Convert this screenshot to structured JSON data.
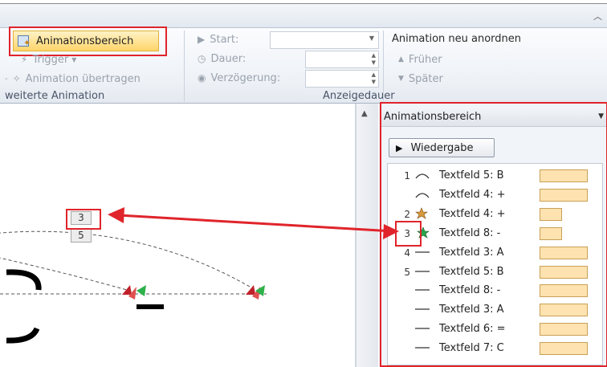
{
  "ribbon": {
    "collapse_icon": "chevron-up-icon",
    "advanced": {
      "anim_pane_button": "Animationsbereich",
      "trigger": "Trigger",
      "anim_painter": "Animation übertragen",
      "group_label": "weiterte Animation"
    },
    "timing": {
      "start_label": "Start:",
      "duration_label": "Dauer:",
      "delay_label": "Verzögerung:",
      "group_label": "Anzeigedauer"
    },
    "reorder": {
      "title": "Animation neu anordnen",
      "earlier": "Früher",
      "later": "Später"
    }
  },
  "slide": {
    "tag_top": "3",
    "tag_bottom": "5"
  },
  "pane": {
    "title": "Animationsbereich",
    "play_label": "Wiedergabe",
    "items": [
      {
        "num": "1",
        "icon": "arc-path-icon",
        "label": "Textfeld 5: B",
        "bar": 58
      },
      {
        "num": "",
        "icon": "arc-path-icon",
        "label": "Textfeld 4: +",
        "bar": 58
      },
      {
        "num": "2",
        "icon": "star-emphasis-icon",
        "label": "Textfeld 4: +",
        "bar": 26
      },
      {
        "num": "3",
        "icon": "star-emphasis-icon",
        "label": "Textfeld 8: -",
        "bar": 26
      },
      {
        "num": "4",
        "icon": "line-path-icon",
        "label": "Textfeld 3: A",
        "bar": 58
      },
      {
        "num": "5",
        "icon": "line-path-icon",
        "label": "Textfeld 5: B",
        "bar": 58
      },
      {
        "num": "",
        "icon": "line-path-icon",
        "label": "Textfeld 8: -",
        "bar": 58
      },
      {
        "num": "",
        "icon": "line-path-icon",
        "label": "Textfeld 3: A",
        "bar": 58
      },
      {
        "num": "",
        "icon": "line-path-icon",
        "label": "Textfeld 6: =",
        "bar": 58
      },
      {
        "num": "",
        "icon": "line-path-icon",
        "label": "Textfeld 7: C",
        "bar": 58
      }
    ]
  },
  "colors": {
    "highlight": "#e0242b",
    "timing_bar": "#fee3b0",
    "button_active": "#ffd56b"
  }
}
